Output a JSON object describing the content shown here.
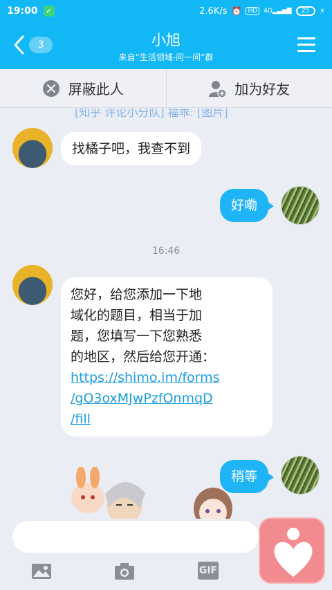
{
  "status_bar": {
    "time": "19:00",
    "app_icon": "message-icon",
    "net_speed": "2.6K/s",
    "hd_label": "HD",
    "network": "4G",
    "battery": "25"
  },
  "header": {
    "back_count": "3",
    "title": "小旭",
    "subtitle": "来自“生活领域-问一问”群"
  },
  "actions": {
    "block_label": "屏蔽此人",
    "add_friend_label": "加为好友"
  },
  "chat": {
    "cut_text": "[知乎 评论小分队] 福乖: [图片]",
    "messages": [
      {
        "side": "left",
        "text": "找橘子吧，我查不到"
      },
      {
        "side": "right",
        "text": "好嘞"
      },
      {
        "side": "left",
        "lines": [
          "您好，给您添加一下地",
          "域化的题目，相当于加",
          "题，您填写一下您熟悉",
          "的地区，然后给您开通："
        ],
        "link_lines": [
          "https://shimo.im/forms",
          "/gO3oxMJwPzfOnmqD",
          "/fill"
        ]
      },
      {
        "side": "right",
        "text": "稍等"
      }
    ],
    "timestamp": "16:46"
  },
  "input": {
    "placeholder": "",
    "gif_label": "GIF"
  },
  "colors": {
    "brand": "#12b7f5",
    "bubble_right": "#1fb4f6",
    "background": "#ebedf5",
    "float_button": "#f28b8f"
  }
}
